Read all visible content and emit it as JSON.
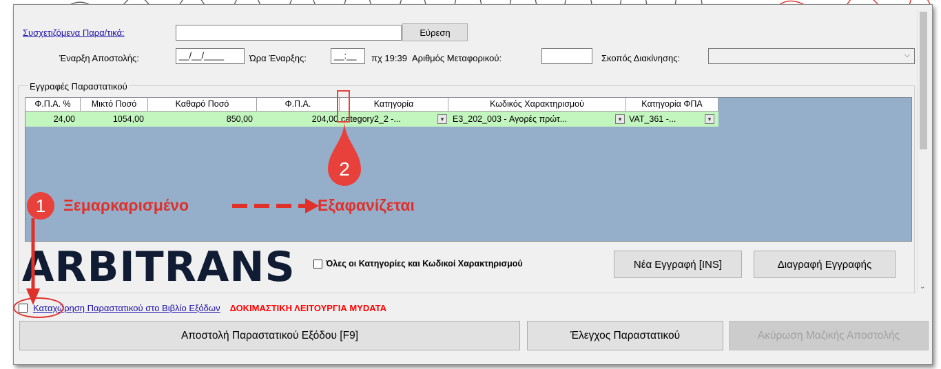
{
  "related_docs": {
    "label": "Συσχετιζόμενα Παρα/τικά:",
    "value": "",
    "find_button": "Εύρεση"
  },
  "shipment": {
    "start_label": "Έναρξη Αποστολής:",
    "start_value": "__/__/____",
    "time_label": "Ώρα Έναρξης:",
    "time_value": "__:__",
    "time_hint": "πχ 19:39",
    "vehicle_label": "Αριθμός Μεταφορικού:",
    "vehicle_value": "",
    "purpose_label": "Σκοπός Διακίνησης:",
    "purpose_value": ""
  },
  "entries": {
    "group_title": "Εγγραφές Παραστατικού",
    "columns": [
      "Φ.Π.Α. %",
      "Μικτό Ποσό",
      "Καθαρό Ποσό",
      "Φ.Π.Α.",
      "Κατηγορία",
      "Κωδικός Χαρακτηρισμού",
      "Κατηγορία ΦΠΑ"
    ],
    "rows": [
      {
        "vat_pct": "24,00",
        "gross": "1054,00",
        "net": "850,00",
        "vat": "204,00",
        "category": "category2_2  -...",
        "code": "E3_202_003  -  Αγορές πρώτ...",
        "vat_category": "VAT_361  -..."
      }
    ]
  },
  "logo": "ARBITRANS",
  "all_categories_label": "Όλες οι Κατηγορίες και Κωδικοί Χαρακτηρισμού",
  "new_entry_button": "Νέα Εγγραφή [INS]",
  "delete_entry_button": "Διαγραφή Εγγραφής",
  "register_link": "Καταχώρηση Παραστατικού στο Βιβλίο Εξόδων",
  "test_mode_label": "ΔΟΚΙΜΑΣΤΙΚΗ ΛΕΙΤΟΥΡΓΙΑ MYDATA",
  "send_button": "Αποστολή Παραστατικού Εξόδου [F9]",
  "check_button": "Έλεγχος Παραστατικού",
  "cancel_bulk_button": "Ακύρωση Μαζικής Αποστολής",
  "annotation": {
    "marker1": "1",
    "marker2": "2",
    "unchecked": "Ξεμαρκαρισμένο",
    "disappears": "Εξαφανίζεται"
  },
  "colors": {
    "row_highlight": "#c3f5bf",
    "grid_bg": "#95afcb",
    "annotation_red": "#e0302a",
    "test_red": "#ff0000",
    "link_blue": "#1a0dab"
  }
}
